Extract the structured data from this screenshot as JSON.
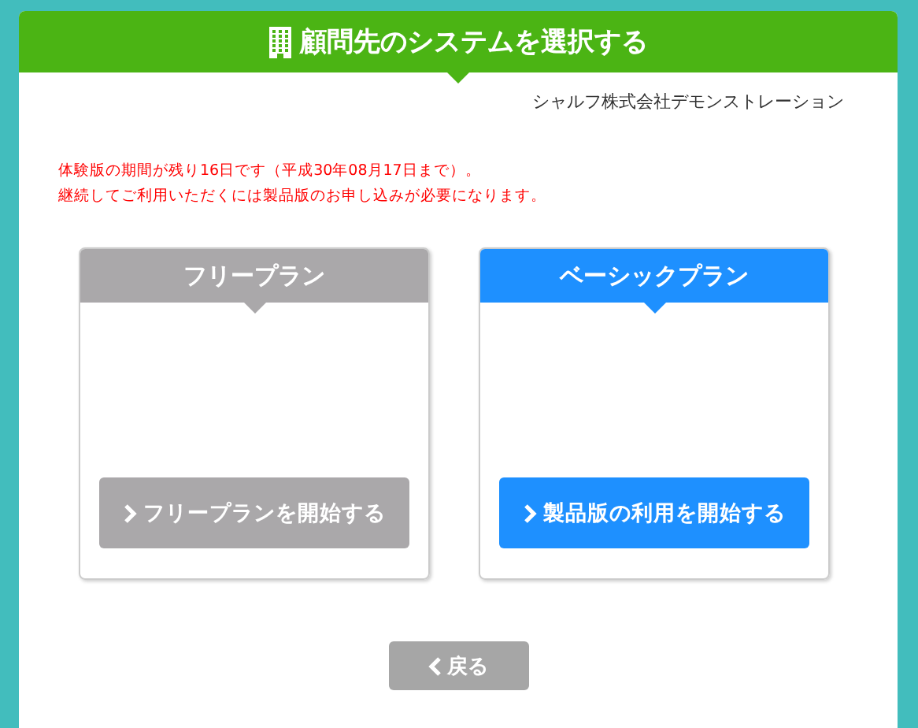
{
  "header": {
    "title": "顧問先のシステムを選択する"
  },
  "company": "シャルフ株式会社デモンストレーション",
  "notice": [
    "体験版の期間が残り16日です（平成30年08月17日まで）。",
    "継続してご利用いただくには製品版のお申し込みが必要になります。"
  ],
  "plans": [
    {
      "kind": "free",
      "title": "フリープラン",
      "button": "フリープランを開始する"
    },
    {
      "kind": "basic",
      "title": "ベーシックプラン",
      "button": "製品版の利用を開始する"
    }
  ],
  "back_button": "戻る"
}
